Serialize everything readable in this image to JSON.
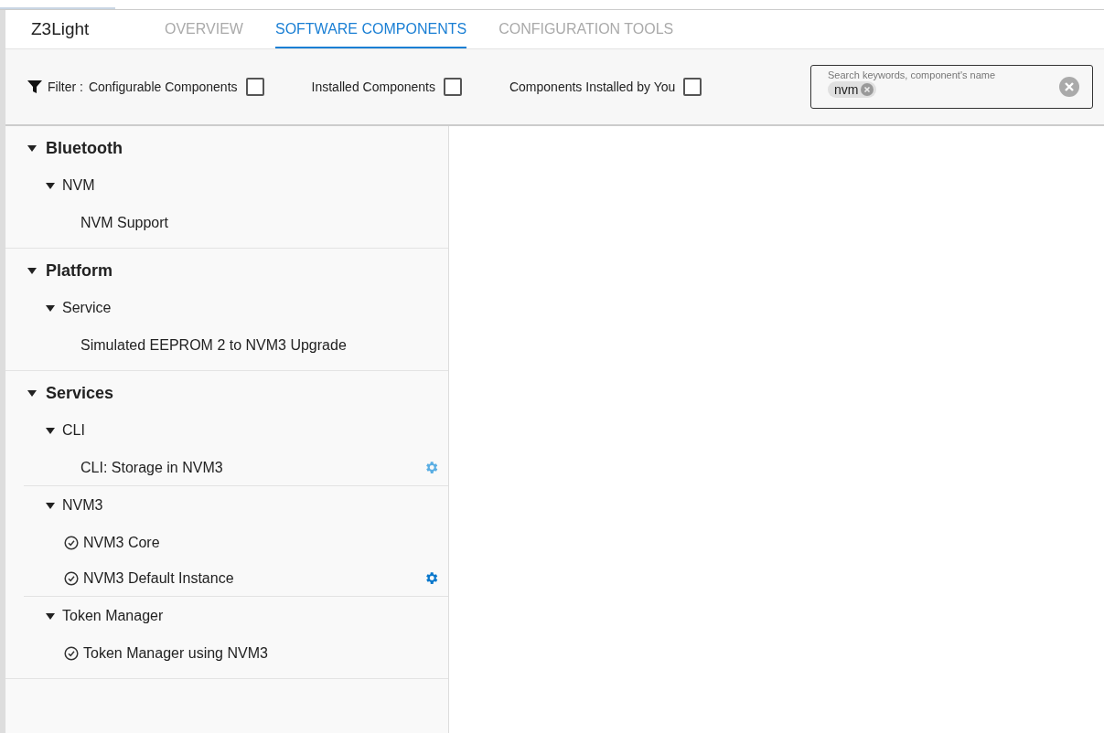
{
  "project": {
    "title": "Z3Light"
  },
  "tabs": [
    {
      "label": "OVERVIEW",
      "selected": false
    },
    {
      "label": "SOFTWARE COMPONENTS",
      "selected": true
    },
    {
      "label": "CONFIGURATION TOOLS",
      "selected": false
    }
  ],
  "filter": {
    "label": "Filter :",
    "options": [
      {
        "label": "Configurable Components",
        "checked": false
      },
      {
        "label": "Installed Components",
        "checked": false
      },
      {
        "label": "Components Installed by You",
        "checked": false
      }
    ]
  },
  "search": {
    "placeholder": "Search keywords, component's name",
    "chips": [
      "nvm"
    ]
  },
  "tree": [
    {
      "label": "Bluetooth",
      "expanded": true,
      "children": [
        {
          "label": "NVM",
          "expanded": true,
          "children": [
            {
              "label": "NVM Support",
              "installed": false,
              "configurable": false
            }
          ]
        }
      ]
    },
    {
      "label": "Platform",
      "expanded": true,
      "children": [
        {
          "label": "Service",
          "expanded": true,
          "children": [
            {
              "label": "Simulated EEPROM 2 to NVM3 Upgrade",
              "installed": false,
              "configurable": false
            }
          ]
        }
      ]
    },
    {
      "label": "Services",
      "expanded": true,
      "children": [
        {
          "label": "CLI",
          "expanded": true,
          "children": [
            {
              "label": "CLI: Storage in NVM3",
              "installed": false,
              "configurable": true
            }
          ]
        },
        {
          "label": "NVM3",
          "expanded": true,
          "children": [
            {
              "label": "NVM3 Core",
              "installed": true,
              "configurable": false
            },
            {
              "label": "NVM3 Default Instance",
              "installed": true,
              "configurable": true
            }
          ]
        },
        {
          "label": "Token Manager",
          "expanded": true,
          "children": [
            {
              "label": "Token Manager using NVM3",
              "installed": true,
              "configurable": false
            }
          ]
        }
      ]
    }
  ]
}
